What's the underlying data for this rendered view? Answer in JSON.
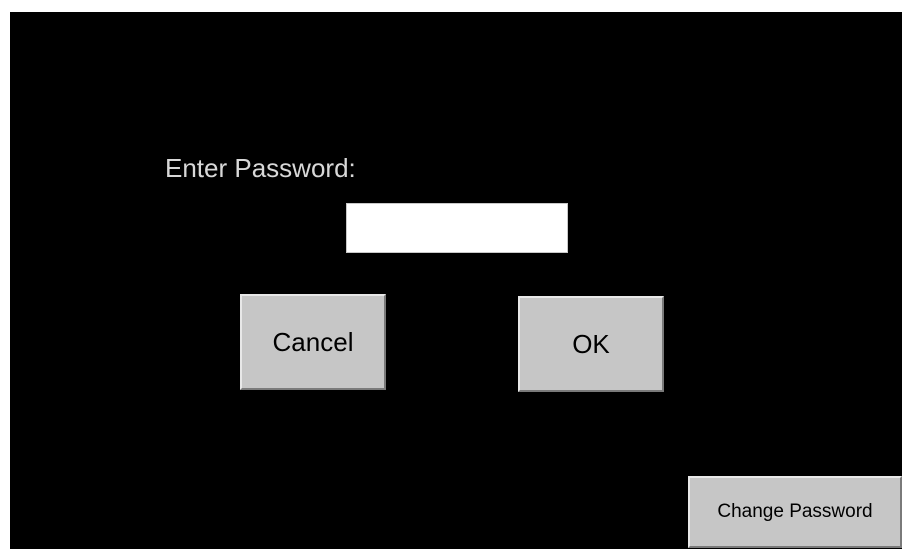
{
  "dialog": {
    "prompt_label": "Enter Password:",
    "password_value": "",
    "cancel_label": "Cancel",
    "ok_label": "OK",
    "change_password_label": "Change Password"
  },
  "colors": {
    "background": "#000000",
    "label_text": "#d8d8d8",
    "button_face": "#c6c6c6",
    "input_background": "#ffffff"
  }
}
